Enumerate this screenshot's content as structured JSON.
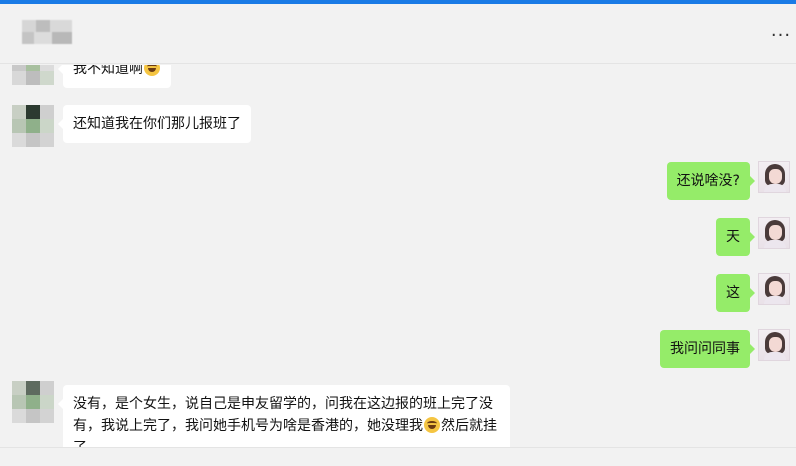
{
  "header": {
    "more_label": "..."
  },
  "messages": [
    {
      "direction": "in",
      "text": "我不知道啊",
      "emoji": "laughing-face"
    },
    {
      "direction": "in",
      "text": "还知道我在你们那儿报班了"
    },
    {
      "direction": "out",
      "text": "还说啥没?"
    },
    {
      "direction": "out",
      "text": "天"
    },
    {
      "direction": "out",
      "text": "这"
    },
    {
      "direction": "out",
      "text": "我问问同事"
    },
    {
      "direction": "in",
      "text_before": "没有，是个女生，说自己是申友留学的，问我在这边报的班上完了没有，我说上完了，我问她手机号为啥是香港的，她没理我",
      "emoji": "laughing-face",
      "text_after": "然后就挂了"
    }
  ],
  "colors": {
    "outgoing_bubble": "#95ec69",
    "incoming_bubble": "#ffffff",
    "background": "#f2f2f2",
    "accent": "#1a7be6"
  }
}
